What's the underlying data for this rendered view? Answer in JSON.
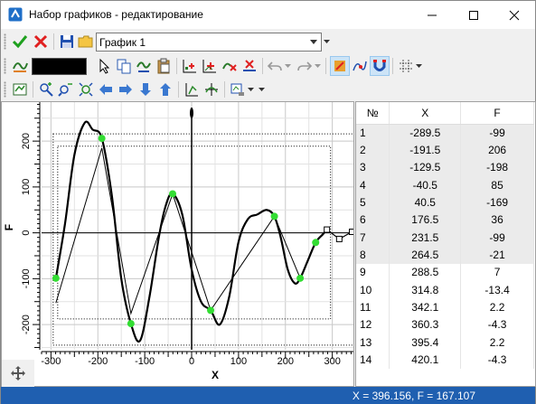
{
  "window": {
    "title": "Набор графиков - редактирование"
  },
  "toolbar": {
    "graph_select_value": "График 1",
    "line_color": "#000000"
  },
  "chart_data": {
    "type": "line",
    "xlabel": "X",
    "ylabel": "F",
    "xlim": [
      -320,
      345
    ],
    "ylim": [
      -255,
      285
    ],
    "x_ticks": [
      -300,
      -200,
      -100,
      0,
      100,
      200,
      300
    ],
    "y_ticks": [
      200,
      100,
      0,
      -100,
      -200
    ],
    "tick_labels_x": [
      "-300",
      "-200",
      "-100",
      "0",
      "100",
      "200",
      "300"
    ],
    "tick_labels_y": [
      "200",
      "100",
      "0",
      "-100",
      "-200"
    ],
    "grid": true,
    "series": [
      {
        "style": "thin-polyline",
        "x": [
          -289.5,
          -191.5,
          -129.5,
          -40.5,
          40.5,
          176.5,
          231.5,
          264.5,
          288.5
        ],
        "y": [
          -153,
          185,
          -176,
          85,
          -169,
          36,
          -99,
          -21,
          7
        ]
      },
      {
        "style": "smooth-curve",
        "x": [
          -289.5,
          -270,
          -250,
          -228,
          -211,
          -191.5,
          -170,
          -150,
          -129.5,
          -110,
          -90,
          -70,
          -55,
          -40.5,
          -20,
          0,
          20,
          40.5,
          60,
          80,
          100,
          120,
          140,
          160,
          176.5,
          190,
          205,
          220,
          231.5,
          248,
          264.5,
          280,
          288.5
        ],
        "y": [
          -99,
          20,
          170,
          240,
          225,
          206,
          80,
          -100,
          -198,
          -235,
          -140,
          -10,
          60,
          85,
          40,
          -80,
          -150,
          -169,
          -200,
          -140,
          -20,
          30,
          40,
          50,
          36,
          -10,
          -80,
          -110,
          -99,
          -60,
          -21,
          -3,
          7
        ]
      },
      {
        "style": "markers-green",
        "x": [
          -289.5,
          -191.5,
          -129.5,
          -40.5,
          40.5,
          176.5,
          231.5,
          264.5
        ],
        "y": [
          -99,
          206,
          -198,
          85,
          -169,
          36,
          -99,
          -21
        ]
      },
      {
        "style": "markers-square",
        "x": [
          288.5,
          314.8,
          342.1,
          360.3,
          395.4,
          420.1
        ],
        "y": [
          7,
          -13.4,
          2.2,
          -4.3,
          2.2,
          -4.3
        ]
      }
    ]
  },
  "table": {
    "columns": [
      "№",
      "X",
      "F"
    ],
    "rows": [
      [
        "1",
        "-289.5",
        "-99"
      ],
      [
        "2",
        "-191.5",
        "206"
      ],
      [
        "3",
        "-129.5",
        "-198"
      ],
      [
        "4",
        "-40.5",
        "85"
      ],
      [
        "5",
        "40.5",
        "-169"
      ],
      [
        "6",
        "176.5",
        "36"
      ],
      [
        "7",
        "231.5",
        "-99"
      ],
      [
        "8",
        "264.5",
        "-21"
      ],
      [
        "9",
        "288.5",
        "7"
      ],
      [
        "10",
        "314.8",
        "-13.4"
      ],
      [
        "11",
        "342.1",
        "2.2"
      ],
      [
        "12",
        "360.3",
        "-4.3"
      ],
      [
        "13",
        "395.4",
        "2.2"
      ],
      [
        "14",
        "420.1",
        "-4.3"
      ]
    ],
    "selected_count": 8
  },
  "status": {
    "coordinates": "X = 396.156, F = 167.107"
  },
  "colors": {
    "marker": "#33dd33",
    "status_bg": "#1f5fb0",
    "accent": "#1f5fb0"
  }
}
